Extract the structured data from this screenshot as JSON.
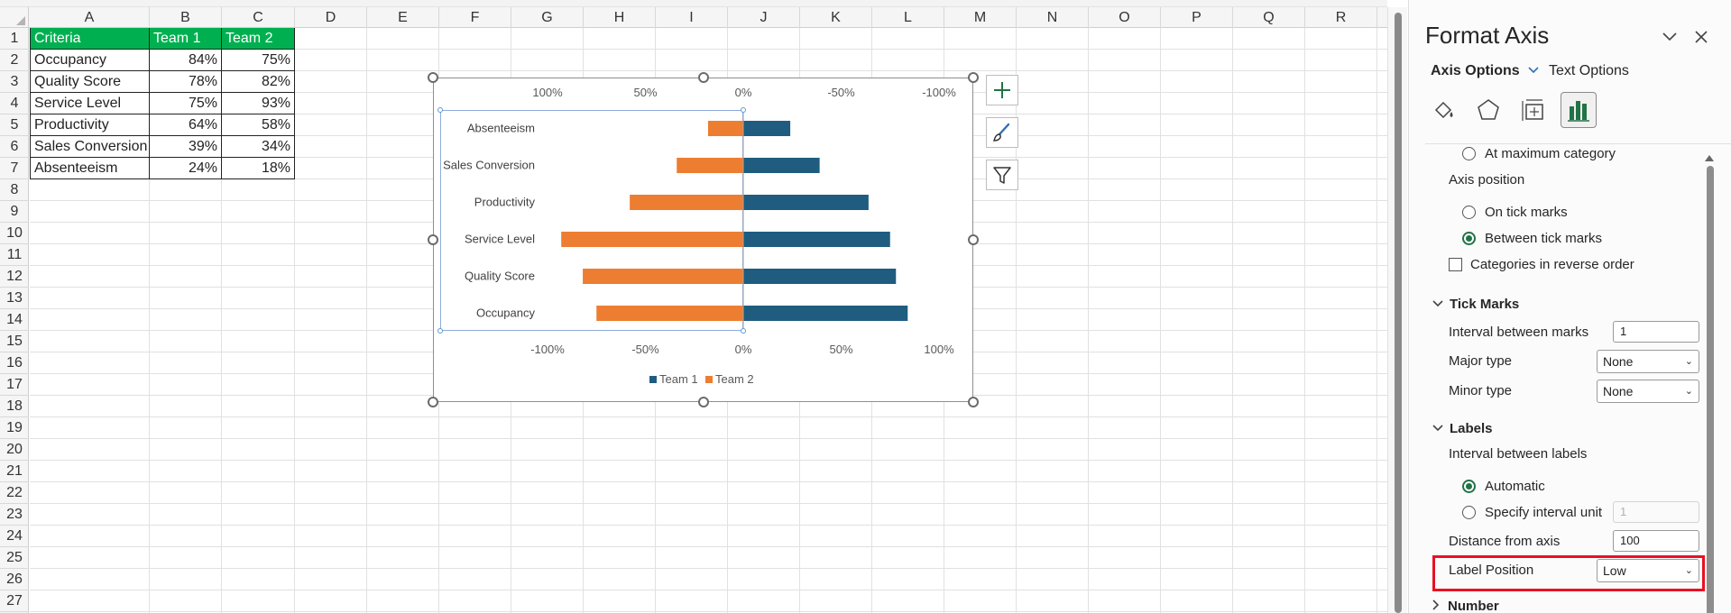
{
  "sheet": {
    "columns": [
      "A",
      "B",
      "C",
      "D",
      "E",
      "F",
      "G",
      "H",
      "I",
      "J",
      "K",
      "L",
      "M",
      "N",
      "O",
      "P",
      "Q",
      "R"
    ],
    "rows": [
      "1",
      "2",
      "3",
      "4",
      "5",
      "6",
      "7",
      "8",
      "9",
      "10",
      "11",
      "12",
      "13",
      "14",
      "15",
      "16",
      "17",
      "18",
      "19",
      "20",
      "21",
      "22",
      "23",
      "24",
      "25",
      "26",
      "27"
    ],
    "table": {
      "headers": [
        "Criteria",
        "Team 1",
        "Team 2"
      ],
      "rows": [
        [
          "Occupancy",
          "84%",
          "75%"
        ],
        [
          "Quality Score",
          "78%",
          "82%"
        ],
        [
          "Service Level",
          "75%",
          "93%"
        ],
        [
          "Productivity",
          "64%",
          "58%"
        ],
        [
          "Sales Conversion",
          "39%",
          "34%"
        ],
        [
          "Absenteeism",
          "24%",
          "18%"
        ]
      ]
    }
  },
  "chart_data": {
    "type": "bar",
    "orientation": "horizontal",
    "categories": [
      "Absenteeism",
      "Sales Conversion",
      "Productivity",
      "Service Level",
      "Quality Score",
      "Occupancy"
    ],
    "series": [
      {
        "name": "Team 1",
        "color": "#1f5c7f",
        "values": [
          0.24,
          0.39,
          0.64,
          0.75,
          0.78,
          0.84
        ]
      },
      {
        "name": "Team 2",
        "color": "#ed7d31",
        "values": [
          -0.18,
          -0.34,
          -0.58,
          -0.93,
          -0.82,
          -0.75
        ]
      }
    ],
    "xlim": [
      -1.55,
      1.55
    ],
    "bottom_ticks": [
      {
        "value": -1.0,
        "label": "-100%"
      },
      {
        "value": -0.5,
        "label": "-50%"
      },
      {
        "value": 0,
        "label": "0%"
      },
      {
        "value": 0.5,
        "label": "50%"
      },
      {
        "value": 1.0,
        "label": "100%"
      }
    ],
    "top_ticks": [
      {
        "value": -1.0,
        "label": "100%"
      },
      {
        "value": -0.5,
        "label": "50%"
      },
      {
        "value": 0,
        "label": "0%"
      },
      {
        "value": 0.5,
        "label": "-50%"
      },
      {
        "value": 1.0,
        "label": "-100%"
      }
    ],
    "legend": {
      "position": "bottom",
      "entries": [
        "Team 1",
        "Team 2"
      ]
    },
    "grid": false
  },
  "chart_buttons": {
    "add": "+",
    "style": "paintbrush-icon",
    "filter": "filter-icon"
  },
  "pane": {
    "title": "Format Axis",
    "tabs": {
      "axis_options": "Axis Options",
      "text_options": "Text Options"
    },
    "icons": [
      "fill-line-icon",
      "effects-icon",
      "size-properties-icon",
      "axis-options-icon"
    ],
    "axis_at_max": "At maximum category",
    "axis_position": {
      "label": "Axis position",
      "options": [
        "On tick marks",
        "Between tick marks"
      ],
      "selected": "Between tick marks"
    },
    "reverse_order": "Categories in reverse order",
    "tick_marks": {
      "section": "Tick Marks",
      "interval_label": "Interval between marks",
      "interval_value": "1",
      "major_label": "Major type",
      "major_value": "None",
      "minor_label": "Minor type",
      "minor_value": "None"
    },
    "labels": {
      "section": "Labels",
      "interval_label": "Interval between labels",
      "automatic": "Automatic",
      "specify": "Specify interval unit",
      "specify_value": "1",
      "distance_label": "Distance from axis",
      "distance_value": "100",
      "position_label": "Label Position",
      "position_value": "Low"
    },
    "number_section": "Number"
  }
}
